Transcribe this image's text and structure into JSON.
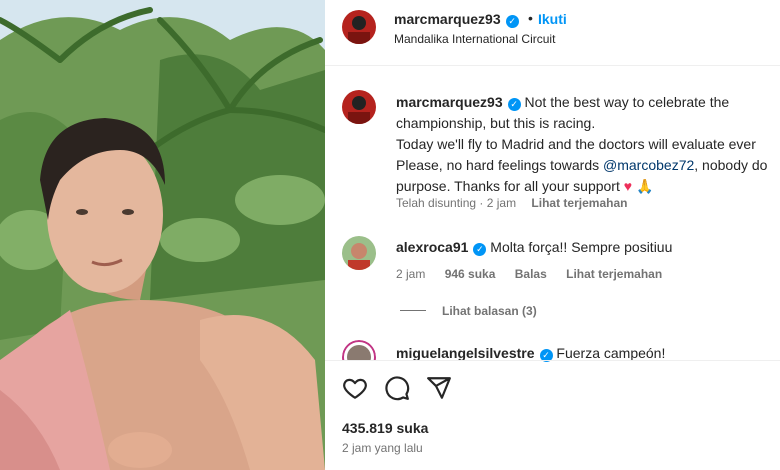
{
  "post": {
    "username": "marcmarquez93",
    "follow_label": "Ikuti",
    "separator": "•",
    "location": "Mandalika International Circuit"
  },
  "caption": {
    "username": "marcmarquez93",
    "line1": "Not the best way to celebrate the",
    "line2": "championship, but this is racing.",
    "line3": "Today we'll fly to Madrid and the doctors will evaluate ever",
    "line4_before": "Please, no hard feelings towards ",
    "line4_mention": "@marcobez72",
    "line4_after": ", nobody do",
    "line5": "purpose. Thanks for all your support",
    "heart": "♥",
    "emoji_hands": "🙏",
    "edited": "Telah disunting",
    "edited_time": "2 jam",
    "translate": "Lihat terjemahan"
  },
  "comments": [
    {
      "username": "alexroca91",
      "text": "Molta força!! Sempre positiuu",
      "time": "2 jam",
      "likes": "946 suka",
      "reply": "Balas",
      "translate": "Lihat terjemahan",
      "view_replies": "Lihat balasan (3)"
    },
    {
      "username": "miguelangelsilvestre",
      "text": "Fuerza campeón!"
    }
  ],
  "footer": {
    "likes": "435.819 suka",
    "time": "2 jam yang lalu"
  },
  "colors": {
    "accent": "#0095f6",
    "mention": "#00376b",
    "heart": "#ed2f5a",
    "muted": "#737373"
  },
  "icons": [
    "verified-badge-icon",
    "like-icon",
    "comment-icon",
    "share-icon"
  ]
}
